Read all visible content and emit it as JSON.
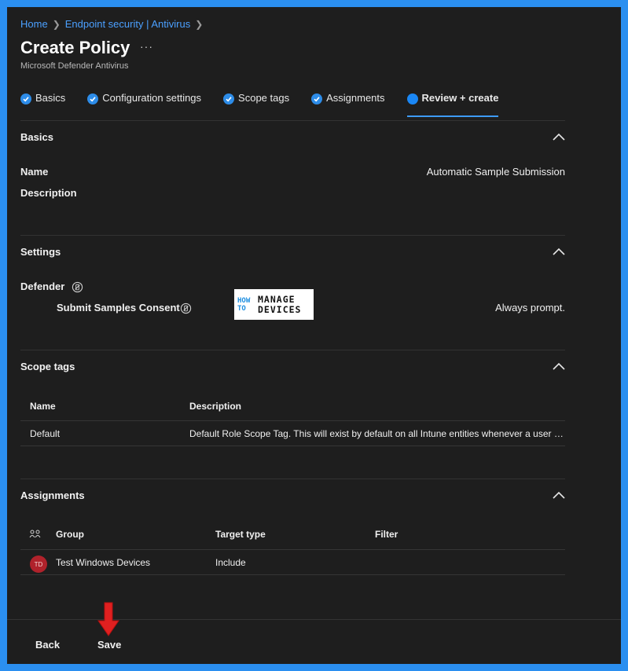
{
  "breadcrumb": {
    "home": "Home",
    "section": "Endpoint security | Antivirus"
  },
  "header": {
    "title": "Create Policy",
    "more": "···",
    "subtitle": "Microsoft Defender Antivirus"
  },
  "tabs": [
    {
      "label": "Basics",
      "state": "done"
    },
    {
      "label": "Configuration settings",
      "state": "done"
    },
    {
      "label": "Scope tags",
      "state": "done"
    },
    {
      "label": "Assignments",
      "state": "done"
    },
    {
      "label": "Review + create",
      "state": "active"
    }
  ],
  "basics": {
    "title": "Basics",
    "name_label": "Name",
    "name_value": "Automatic Sample Submission",
    "description_label": "Description"
  },
  "settings": {
    "title": "Settings",
    "group": "Defender",
    "setting_label": "Submit Samples Consent",
    "setting_value": "Always prompt."
  },
  "watermark": {
    "line1": "HOW",
    "line2": "TO",
    "line3": "MANAGE",
    "line4": "DEVICES"
  },
  "scope_tags": {
    "title": "Scope tags",
    "columns": [
      "Name",
      "Description"
    ],
    "rows": [
      [
        "Default",
        "Default Role Scope Tag. This will exist by default on all Intune entities whenever a user …"
      ]
    ]
  },
  "assignments": {
    "title": "Assignments",
    "columns": [
      "Group",
      "Target type",
      "Filter"
    ],
    "rows": [
      {
        "initials": "TD",
        "group": "Test Windows Devices",
        "target": "Include",
        "filter": ""
      }
    ]
  },
  "footer": {
    "back": "Back",
    "save": "Save"
  },
  "colors": {
    "accent": "#1a87f5",
    "link": "#4ba0ff",
    "avatar": "#b0222b",
    "arrow": "#e02020",
    "border": "#2b8ff0"
  }
}
